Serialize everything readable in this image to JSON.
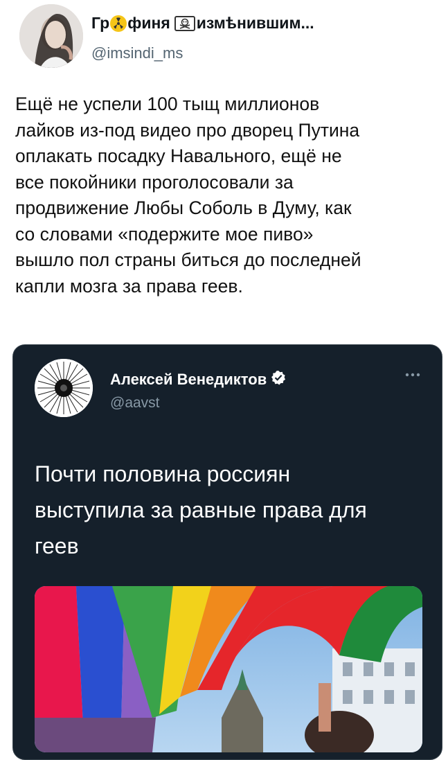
{
  "author": {
    "name_part1": "Гр",
    "name_part2": "финя",
    "name_part3": "измѣнившим...",
    "handle": "@imsindi_ms"
  },
  "tweet": {
    "lines": [
      "Ещё не успели 100 тыщ миллионов",
      "лайков из-под видео про дворец Путина",
      "оплакать посадку Навального, ещё не",
      "все покойники проголосовали за",
      "продвижение Любы Соболь в Думу, как",
      "со словами «подержите мое пиво»",
      "вышло пол страны биться до последней",
      "капли мозга за права геев."
    ]
  },
  "quoted": {
    "name": "Алексей Венедиктов",
    "handle": "@aavst",
    "lines": [
      "Почти половина россиян",
      "выступила за равные права для",
      "геев"
    ]
  },
  "icons": {
    "emoji": "radioactive-emoji-icon",
    "skull": "skull-crossbones-icon",
    "verified": "verified-badge-icon",
    "more": "more-options-icon"
  },
  "colors": {
    "card_bg": "#15202b",
    "handle_gray": "#536471",
    "verified_blue": "#1d9bf0"
  }
}
